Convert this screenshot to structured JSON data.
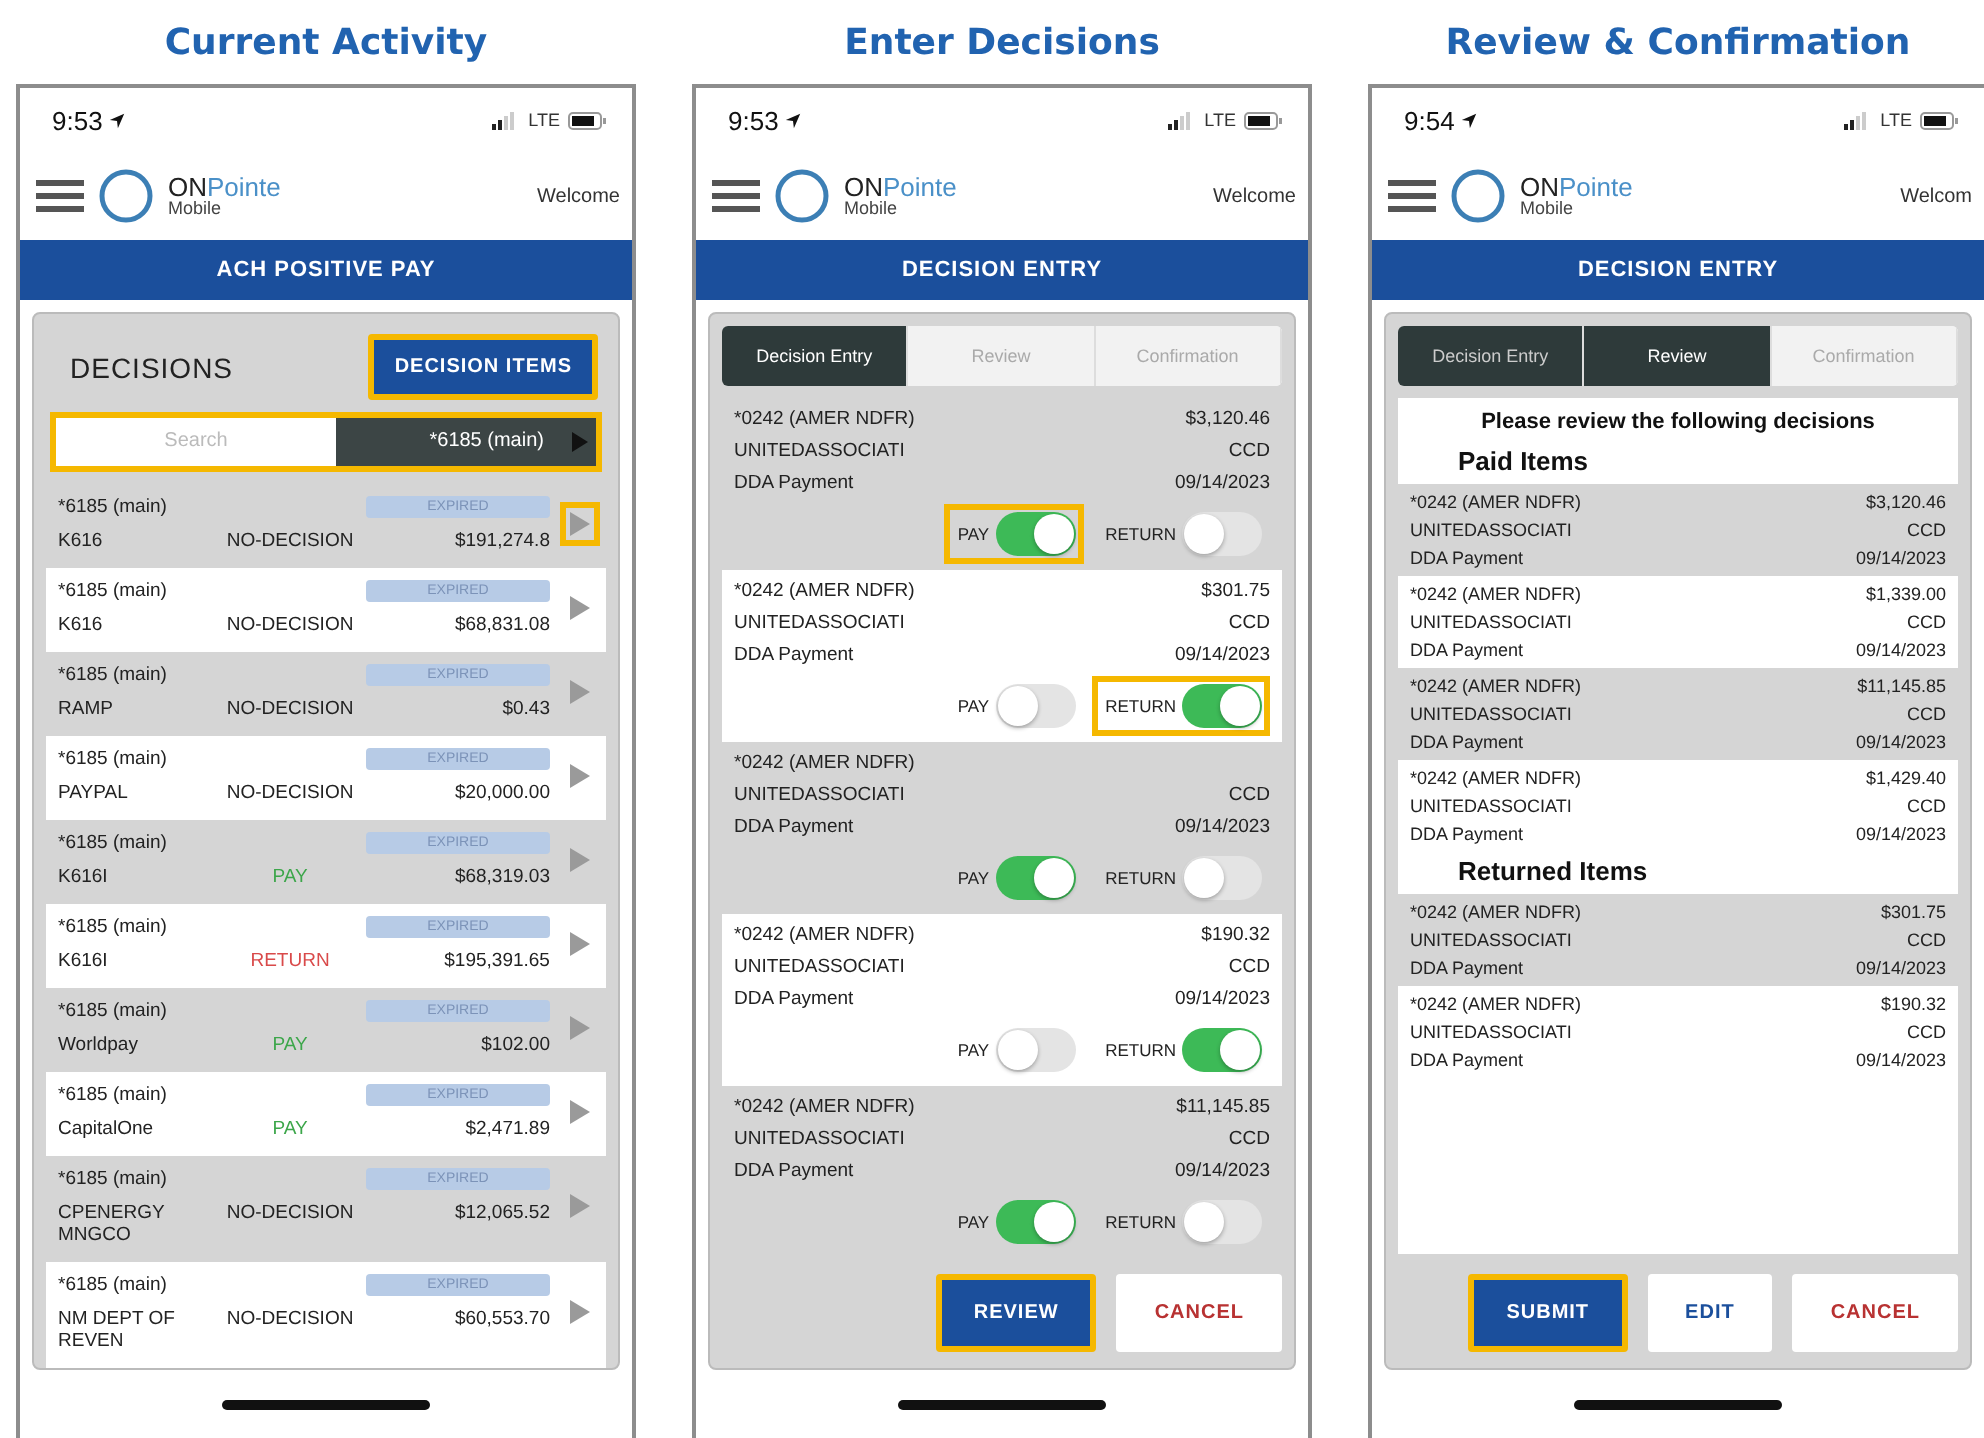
{
  "panels": [
    {
      "heading": "Current Activity",
      "screen": {
        "kind": "activity",
        "time": "9:53",
        "network": "LTE",
        "logo_top": "**ON**Pointe",
        "logo_bottom": "Mobile",
        "welcome": "Welcome",
        "title": "ACH POSITIVE PAY",
        "section_title": "DECISIONS",
        "action": {
          "label": "DECISION ITEMS",
          "highlighted": true
        },
        "filter": {
          "placeholder": "Search",
          "account": "*6185 (main)",
          "highlighted": true
        },
        "rows": [
          {
            "account": "*6185 (main)",
            "status": "EXPIRED",
            "payee": "K616",
            "decision": "NO-DECISION",
            "kind": "none",
            "amount": "$191,274.8",
            "highlighted": true
          },
          {
            "account": "*6185 (main)",
            "status": "EXPIRED",
            "payee": "K616",
            "decision": "NO-DECISION",
            "kind": "none",
            "amount": "$68,831.08",
            "highlighted": false
          },
          {
            "account": "*6185 (main)",
            "status": "EXPIRED",
            "payee": "RAMP",
            "decision": "NO-DECISION",
            "kind": "none",
            "amount": "$0.43",
            "highlighted": false
          },
          {
            "account": "*6185 (main)",
            "status": "EXPIRED",
            "payee": "PAYPAL",
            "decision": "NO-DECISION",
            "kind": "none",
            "amount": "$20,000.00",
            "highlighted": false
          },
          {
            "account": "*6185 (main)",
            "status": "EXPIRED",
            "payee": "K616I",
            "decision": "PAY",
            "kind": "pay",
            "amount": "$68,319.03",
            "highlighted": false
          },
          {
            "account": "*6185 (main)",
            "status": "EXPIRED",
            "payee": "K616I",
            "decision": "RETURN",
            "kind": "return",
            "amount": "$195,391.65",
            "highlighted": false
          },
          {
            "account": "*6185 (main)",
            "status": "EXPIRED",
            "payee": "Worldpay",
            "decision": "PAY",
            "kind": "pay",
            "amount": "$102.00",
            "highlighted": false
          },
          {
            "account": "*6185 (main)",
            "status": "EXPIRED",
            "payee": "CapitalOne",
            "decision": "PAY",
            "kind": "pay",
            "amount": "$2,471.89",
            "highlighted": false
          },
          {
            "account": "*6185 (main)",
            "status": "EXPIRED",
            "payee": "CPENERGY MNGCO",
            "decision": "NO-DECISION",
            "kind": "none",
            "amount": "$12,065.52",
            "highlighted": false
          },
          {
            "account": "*6185 (main)",
            "status": "EXPIRED",
            "payee": "NM DEPT OF REVEN",
            "decision": "NO-DECISION",
            "kind": "none",
            "amount": "$60,553.70",
            "highlighted": false
          }
        ]
      }
    },
    {
      "heading": "Enter Decisions",
      "screen": {
        "kind": "entry",
        "time": "9:53",
        "network": "LTE",
        "logo_top": "**ON**Pointe",
        "logo_bottom": "Mobile",
        "welcome": "Welcome",
        "title": "DECISION ENTRY",
        "tabs": [
          {
            "label": "Decision Entry",
            "selected": true,
            "completed": false
          },
          {
            "label": "Review",
            "selected": false,
            "completed": false
          },
          {
            "label": "Confirmation",
            "selected": false,
            "completed": false
          }
        ],
        "rows": [
          {
            "account": "*0242 (AMER NDFR)",
            "amount": "$3,120.46",
            "payee": "UNITEDASSOCIATI",
            "code": "CCD",
            "description": "DDA Payment",
            "date": "09/14/2023",
            "toggles": [
              {
                "label": "PAY",
                "on": true,
                "highlighted": true
              },
              {
                "label": "RETURN",
                "on": false,
                "highlighted": false
              }
            ]
          },
          {
            "account": "*0242 (AMER NDFR)",
            "amount": "$301.75",
            "payee": "UNITEDASSOCIATI",
            "code": "CCD",
            "description": "DDA Payment",
            "date": "09/14/2023",
            "toggles": [
              {
                "label": "PAY",
                "on": false,
                "highlighted": false
              },
              {
                "label": "RETURN",
                "on": true,
                "highlighted": true
              }
            ]
          },
          {
            "account": "*0242 (AMER NDFR)",
            "payee": "UNITEDASSOCIATI",
            "code": "CCD",
            "description": "DDA Payment",
            "date": "09/14/2023",
            "toggles": [
              {
                "label": "PAY",
                "on": true,
                "highlighted": false
              },
              {
                "label": "RETURN",
                "on": false,
                "highlighted": false
              }
            ]
          },
          {
            "account": "*0242 (AMER NDFR)",
            "amount": "$190.32",
            "payee": "UNITEDASSOCIATI",
            "code": "CCD",
            "description": "DDA Payment",
            "date": "09/14/2023",
            "toggles": [
              {
                "label": "PAY",
                "on": false,
                "highlighted": false
              },
              {
                "label": "RETURN",
                "on": true,
                "highlighted": false
              }
            ]
          },
          {
            "account": "*0242 (AMER NDFR)",
            "amount": "$11,145.85",
            "payee": "UNITEDASSOCIATI",
            "code": "CCD",
            "description": "DDA Payment",
            "date": "09/14/2023",
            "toggles": [
              {
                "label": "PAY",
                "on": true,
                "highlighted": false
              },
              {
                "label": "RETURN",
                "on": false,
                "highlighted": false
              }
            ]
          }
        ],
        "buttons": [
          {
            "label": "REVIEW",
            "kind": "primary",
            "highlighted": true
          },
          {
            "label": "CANCEL",
            "kind": "danger",
            "highlighted": false
          }
        ]
      }
    },
    {
      "heading": "Review & Confirmation",
      "screen": {
        "kind": "review",
        "time": "9:54",
        "network": "LTE",
        "logo_top": "**ON**Pointe",
        "logo_bottom": "Mobile",
        "welcome": "Welcom",
        "title": "DECISION ENTRY",
        "tabs": [
          {
            "label": "Decision Entry",
            "selected": false,
            "completed": true
          },
          {
            "label": "Review",
            "selected": true,
            "completed": false
          },
          {
            "label": "Confirmation",
            "selected": false,
            "completed": false
          }
        ],
        "prompt": "Please review the following decisions",
        "groups": [
          {
            "title": "Paid Items",
            "rows": [
              {
                "account": "*0242 (AMER NDFR)",
                "amount": "$3,120.46",
                "payee": "UNITEDASSOCIATI",
                "code": "CCD",
                "description": "DDA Payment",
                "date": "09/14/2023"
              },
              {
                "account": "*0242 (AMER NDFR)",
                "amount": "$1,339.00",
                "payee": "UNITEDASSOCIATI",
                "code": "CCD",
                "description": "DDA Payment",
                "date": "09/14/2023"
              },
              {
                "account": "*0242 (AMER NDFR)",
                "amount": "$11,145.85",
                "payee": "UNITEDASSOCIATI",
                "code": "CCD",
                "description": "DDA Payment",
                "date": "09/14/2023"
              },
              {
                "account": "*0242 (AMER NDFR)",
                "amount": "$1,429.40",
                "payee": "UNITEDASSOCIATI",
                "code": "CCD",
                "description": "DDA Payment",
                "date": "09/14/2023"
              }
            ]
          },
          {
            "title": "Returned Items",
            "rows": [
              {
                "account": "*0242 (AMER NDFR)",
                "amount": "$301.75",
                "payee": "UNITEDASSOCIATI",
                "code": "CCD",
                "description": "DDA Payment",
                "date": "09/14/2023"
              },
              {
                "account": "*0242 (AMER NDFR)",
                "amount": "$190.32",
                "payee": "UNITEDASSOCIATI",
                "code": "CCD",
                "description": "DDA Payment",
                "date": "09/14/2023"
              }
            ]
          }
        ],
        "buttons": [
          {
            "label": "SUBMIT",
            "kind": "primary",
            "highlighted": true
          },
          {
            "label": "EDIT",
            "kind": "outline",
            "highlighted": false
          },
          {
            "label": "CANCEL",
            "kind": "danger",
            "highlighted": false
          }
        ]
      }
    }
  ]
}
